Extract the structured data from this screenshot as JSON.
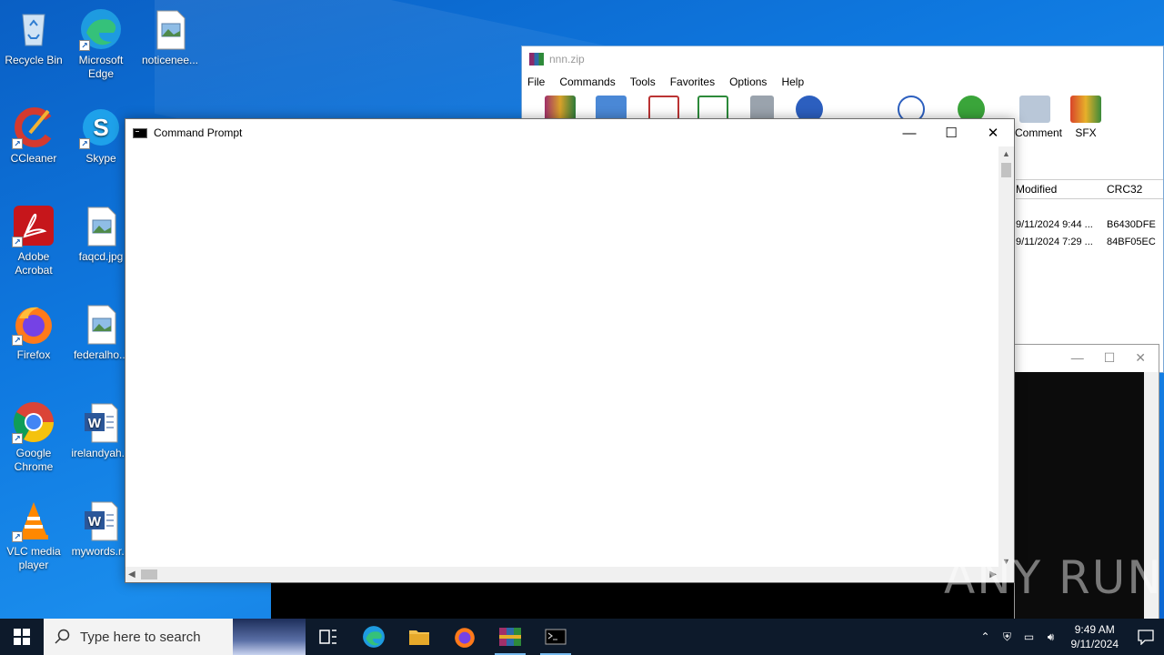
{
  "desktop": {
    "icons": [
      {
        "label": "Recycle Bin",
        "icon": "recycle-bin-icon"
      },
      {
        "label": "Microsoft Edge",
        "icon": "edge-icon"
      },
      {
        "label": "noticenee...",
        "icon": "image-file-icon"
      },
      {
        "label": "CCleaner",
        "icon": "ccleaner-icon"
      },
      {
        "label": "Skype",
        "icon": "skype-icon"
      },
      {
        "label": "Adobe Acrobat",
        "icon": "acrobat-icon"
      },
      {
        "label": "faqcd.jpg",
        "icon": "image-file-icon"
      },
      {
        "label": "Firefox",
        "icon": "firefox-icon"
      },
      {
        "label": "federalho...",
        "icon": "image-file-icon"
      },
      {
        "label": "Google Chrome",
        "icon": "chrome-icon"
      },
      {
        "label": "irelandyah...",
        "icon": "word-doc-icon"
      },
      {
        "label": "VLC media player",
        "icon": "vlc-icon"
      },
      {
        "label": "mywords.r...",
        "icon": "word-doc-icon"
      }
    ]
  },
  "winrar": {
    "title": "nnn.zip",
    "menu": [
      "File",
      "Commands",
      "Tools",
      "Favorites",
      "Options",
      "Help"
    ],
    "toolbar": [
      "Comment",
      "SFX"
    ],
    "columns": [
      "Modified",
      "CRC32"
    ],
    "rows": [
      {
        "modified": "9/11/2024 9:44 ...",
        "crc": "B6430DFE"
      },
      {
        "modified": "9/11/2024 7:29 ...",
        "crc": "84BF05EC"
      }
    ]
  },
  "cmd": {
    "title": "Command Prompt",
    "minimize": "—",
    "maximize": "☐",
    "close": "✕"
  },
  "watermark": "ANY RUN",
  "taskbar": {
    "search_placeholder": "Type here to search",
    "time": "9:49 AM",
    "date": "9/11/2024"
  }
}
